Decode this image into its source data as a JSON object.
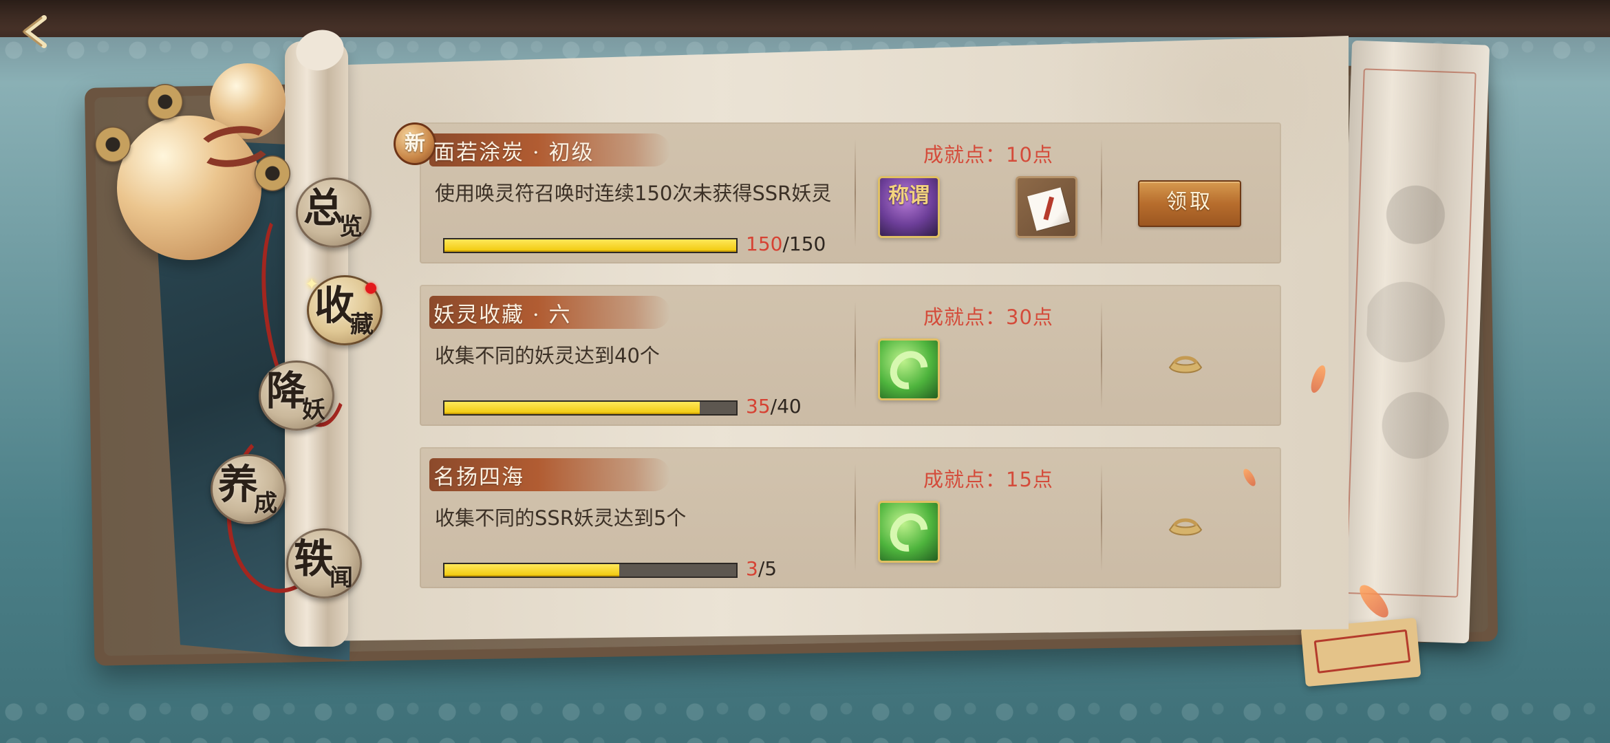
{
  "navigation": {
    "back_icon": "chevron-left-icon",
    "items": [
      {
        "big": "总",
        "small": "览",
        "active": false
      },
      {
        "big": "收",
        "small": "藏",
        "active": true
      },
      {
        "big": "降",
        "small": "妖",
        "active": false
      },
      {
        "big": "养",
        "small": "成",
        "active": false
      },
      {
        "big": "轶",
        "small": "闻",
        "active": false
      }
    ]
  },
  "achievements": [
    {
      "badge": "新",
      "title": "面若涂炭 · 初级",
      "description": "使用唤灵符召唤时连续150次未获得SSR妖灵",
      "progress_current": "150",
      "progress_total": "/150",
      "progress_ratio": 1,
      "points": "成就点：10点",
      "reward_title_text": "称谓",
      "reward_icons": [
        "title-token-icon",
        "letter-icon"
      ],
      "action_label": "领取",
      "state": "claimable"
    },
    {
      "badge": "",
      "title": "妖灵收藏 · 六",
      "description": "收集不同的妖灵达到40个",
      "progress_current": "35",
      "progress_total": "/40",
      "progress_ratio": 0.875,
      "points": "成就点：30点",
      "reward_icons": [
        "jade-icon"
      ],
      "action_icon": "locked-ingot-icon",
      "state": "locked"
    },
    {
      "badge": "",
      "title": "名扬四海",
      "description": "收集不同的SSR妖灵达到5个",
      "progress_current": "3",
      "progress_total": "/5",
      "progress_ratio": 0.6,
      "points": "成就点：15点",
      "reward_icons": [
        "jade-icon"
      ],
      "action_icon": "locked-ingot-icon",
      "state": "locked"
    }
  ],
  "colors": {
    "accent_red": "#d64233",
    "progress_yellow": "#f0c80a",
    "button_brown": "#b76d2d",
    "paper": "#e8dfcf"
  }
}
